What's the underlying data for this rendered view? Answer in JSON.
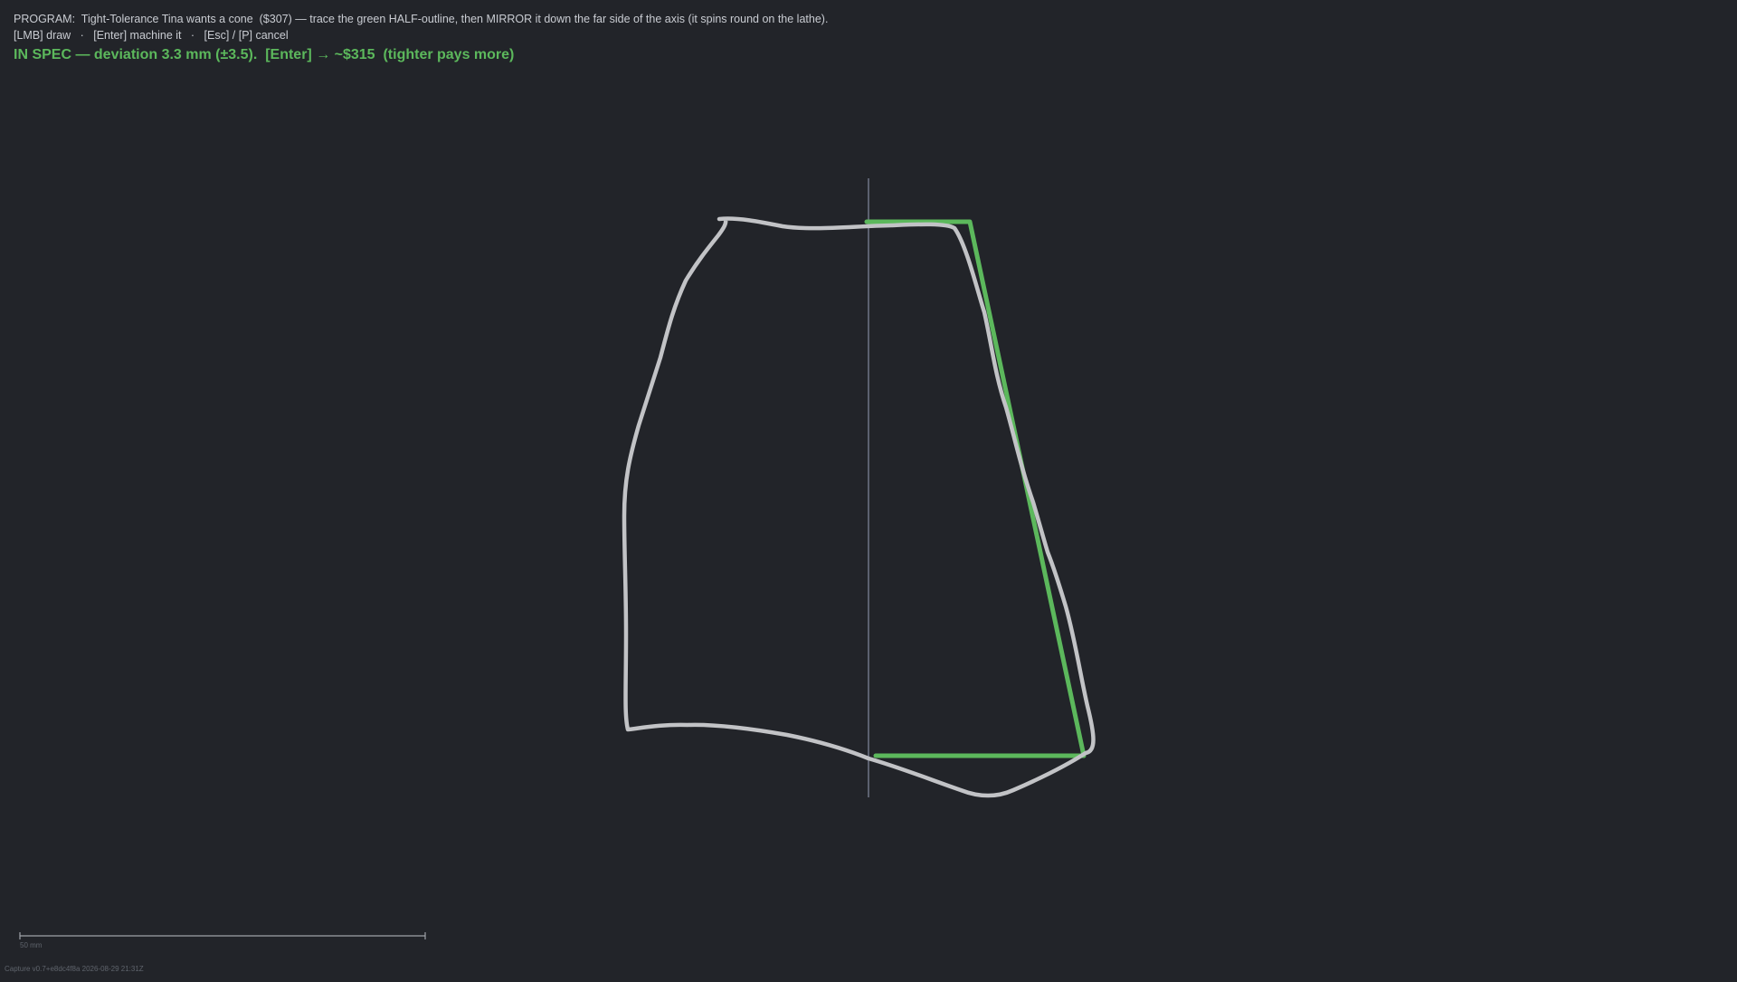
{
  "hud": {
    "program_text": "PROGRAM:  Tight-Tolerance Tina wants a cone  ($307) — trace the green HALF-outline, then MIRROR it down the far side of the axis (it spins round on the lathe).",
    "controls": {
      "draw": "[LMB] draw",
      "separator": "·",
      "machine": "[Enter] machine it",
      "cancel": "[Esc] / [P] cancel"
    },
    "status_text": "IN SPEC — deviation 3.3 mm (±3.5).  [Enter] → ~$315  (tighter pays more)"
  },
  "scale_bar": {
    "label": "50 mm"
  },
  "footer": {
    "capture_stamp": "Capture v0.7+e8dc4f8a 2026-08-29 21:31Z"
  },
  "colors": {
    "background": "#222429",
    "axis": "#5c6170",
    "target_outline": "#5cb85c",
    "player_stroke": "#c2c3c6",
    "status_text": "#5cb85c",
    "hud_text": "#c9ccd2"
  }
}
